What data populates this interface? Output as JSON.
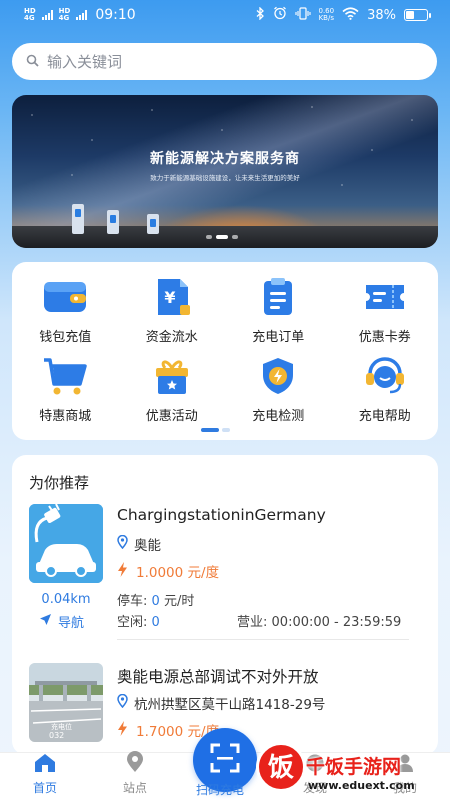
{
  "status_bar": {
    "net1": "4G",
    "net1_sub": "HD",
    "net2": "4G",
    "net2_sub": "HD",
    "time": "09:10",
    "speed_value": "0.60",
    "speed_unit": "KB/s",
    "battery": "38%",
    "battery_level": 0.38
  },
  "search": {
    "placeholder": "输入关键词"
  },
  "banner": {
    "title": "新能源解决方案服务商",
    "subtitle": "致力于新能源基础设施建设，让未来生活更加的美好",
    "slide_count": 3,
    "active_slide": 1
  },
  "menu": {
    "items": [
      {
        "label": "钱包充值",
        "icon": "wallet-icon"
      },
      {
        "label": "资金流水",
        "icon": "yuan-document-icon"
      },
      {
        "label": "充电订单",
        "icon": "clipboard-icon"
      },
      {
        "label": "优惠卡券",
        "icon": "ticket-icon"
      },
      {
        "label": "特惠商城",
        "icon": "shopping-cart-icon"
      },
      {
        "label": "优惠活动",
        "icon": "gift-icon"
      },
      {
        "label": "充电检测",
        "icon": "shield-bolt-icon"
      },
      {
        "label": "充电帮助",
        "icon": "headset-icon"
      }
    ],
    "page_count": 2,
    "active_page": 0
  },
  "recommend": {
    "title": "为你推荐",
    "stations": [
      {
        "name": "ChargingstationinGermany",
        "operator": "奥能",
        "price": "1.0000 元/度",
        "distance": "0.04km",
        "nav_label": "导航",
        "parking_label": "停车:",
        "parking_value": "0",
        "parking_unit": "元/时",
        "idle_label": "空闲:",
        "idle_value": "0",
        "hours_label": "营业:",
        "hours_value": "00:00:00 - 23:59:59"
      },
      {
        "name": "奥能电源总部调试不对外开放",
        "address": "杭州拱墅区莫干山路1418-29号",
        "price": "1.7000 元/度"
      }
    ]
  },
  "tabbar": {
    "items": [
      {
        "label": "首页",
        "icon": "home-icon",
        "active": true
      },
      {
        "label": "站点",
        "icon": "location-pin-icon",
        "active": false
      },
      {
        "label": "扫码充电",
        "icon": "scan-icon",
        "active": false
      },
      {
        "label": "发现",
        "icon": "discover-icon",
        "active": false
      },
      {
        "label": "我的",
        "icon": "user-icon",
        "active": false
      }
    ]
  },
  "watermark": {
    "logo_char": "饭",
    "site_name": "千饭手游网",
    "site_url": "www.eduext.com"
  },
  "colors": {
    "accent": "#2f7be0",
    "price": "#f07b38",
    "header_blue": "#3d9bf0",
    "watermark_red": "#e8221b"
  }
}
